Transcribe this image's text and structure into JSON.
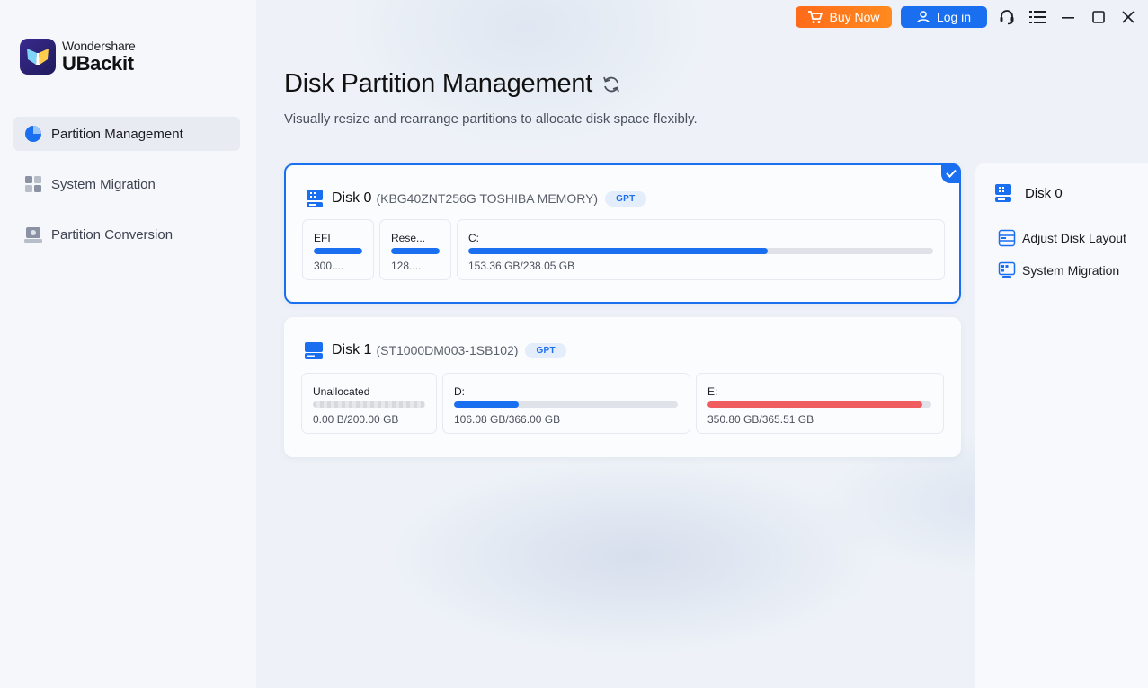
{
  "brand": {
    "name_small": "Wondershare",
    "name_large": "UBackit"
  },
  "topbar": {
    "buy_label": "Buy Now",
    "login_label": "Log in"
  },
  "sidebar": {
    "items": [
      {
        "label": "Partition Management",
        "icon": "pie-chart-icon",
        "active": true
      },
      {
        "label": "System Migration",
        "icon": "migration-grid-icon",
        "active": false
      },
      {
        "label": "Partition Conversion",
        "icon": "drive-convert-icon",
        "active": false
      }
    ]
  },
  "main": {
    "title": "Disk Partition Management",
    "subtitle": "Visually resize and rearrange partitions to allocate disk space flexibly."
  },
  "disks": [
    {
      "name": "Disk 0",
      "model": "(KBG40ZNT256G TOSHIBA MEMORY)",
      "badge": "GPT",
      "selected": true,
      "partitions": [
        {
          "name": "EFI",
          "size": "300....",
          "used_fraction": 1.0
        },
        {
          "name": "Rese...",
          "size": "128....",
          "used_fraction": 1.0
        },
        {
          "name": "C:",
          "size": "153.36 GB/238.05 GB",
          "used_fraction": 0.644
        }
      ]
    },
    {
      "name": "Disk 1",
      "model": "(ST1000DM003-1SB102)",
      "badge": "GPT",
      "selected": false,
      "partitions": [
        {
          "name": "Unallocated",
          "size": "0.00 B/200.00 GB",
          "used_fraction": 0
        },
        {
          "name": "D:",
          "size": "106.08 GB/366.00 GB",
          "used_fraction": 0.29
        },
        {
          "name": "E:",
          "size": "350.80 GB/365.51 GB",
          "used_fraction": 0.96
        }
      ]
    }
  ],
  "right_panel": {
    "title": "Disk 0",
    "actions": [
      {
        "label": "Adjust Disk Layout",
        "icon": "adjust-layout-icon"
      },
      {
        "label": "System Migration",
        "icon": "system-migration-icon"
      }
    ]
  },
  "colors": {
    "accent": "#1a6ff0",
    "buy": "#ff7a1c",
    "danger": "#ef5d60"
  }
}
